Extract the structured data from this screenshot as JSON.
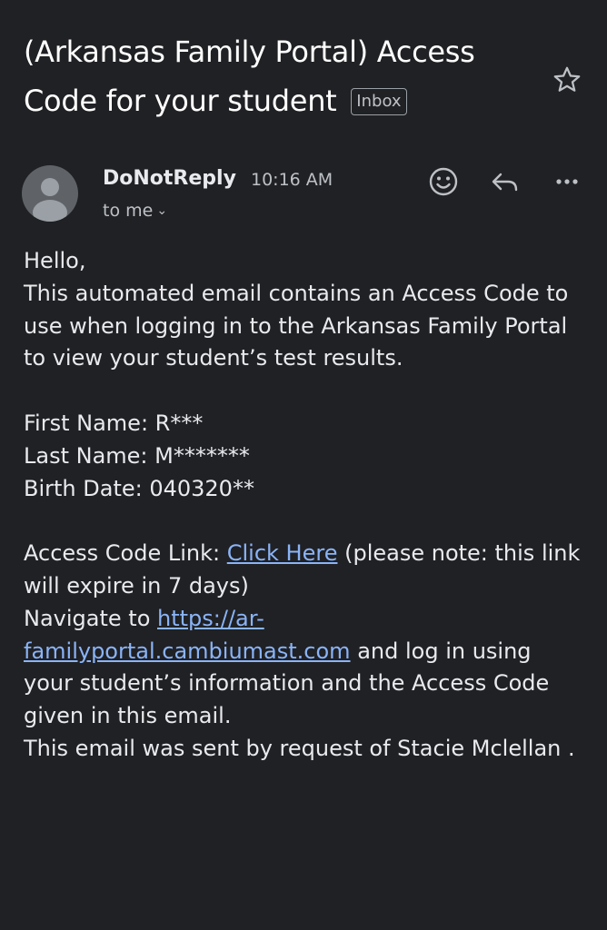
{
  "email": {
    "subject": "(Arkansas Family Portal) Access Code for your student",
    "label_badge": "Inbox",
    "sender": "DoNotReply",
    "time": "10:16 AM",
    "recipient": "to me",
    "body": {
      "greeting": "Hello,",
      "intro": "This automated email contains an Access Code to use when logging in to the Arkansas Family Portal to view your student’s test results.",
      "first_name": "First Name: R***",
      "last_name": "Last Name: M*******",
      "birth_date": "Birth Date: 040320**",
      "access_prefix": "Access Code Link: ",
      "access_link": "Click Here",
      "access_suffix": " (please note: this link will expire in 7 days)",
      "navigate_prefix": "Navigate to ",
      "navigate_link": "https://ar-familyportal.cambiumast.com",
      "navigate_suffix": " and log in using your student’s information and the Access Code given in this email.",
      "footer": "This email was sent by request of Stacie Mclellan ."
    }
  },
  "icons": {
    "star": "star-outline-icon",
    "avatar": "person-icon",
    "emoji": "smiley-icon",
    "reply": "reply-icon",
    "more": "more-horizontal-icon",
    "chevron": "chevron-down-icon"
  },
  "colors": {
    "background": "#202124",
    "text": "#e8eaed",
    "secondary_text": "#bdc1c6",
    "link": "#8ab4f8",
    "avatar_bg": "#5f6368"
  }
}
